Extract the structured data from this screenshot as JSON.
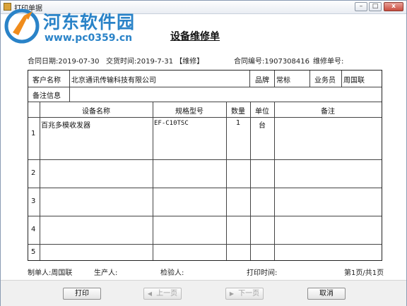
{
  "window": {
    "title": "打印单据",
    "min": "–",
    "max": "□",
    "close": "x"
  },
  "watermark": {
    "site_name": "河东软件园",
    "url": "www.pc0359.cn"
  },
  "doc": {
    "title": "设备维修单"
  },
  "info": {
    "contract_date": "合同日期:2019-07-30",
    "trade_time": "交货时间:2019-7-31 【维修】",
    "contract_no": "合同编号:1907308416",
    "repair_no": "维修单号:"
  },
  "table": {
    "customer_label": "客户名称",
    "customer_value": "北京通讯传输科技有限公司",
    "brand_label": "品牌",
    "brand_value": "常标",
    "sales_label": "业务员",
    "sales_value": "周国联",
    "remark_label": "备注信息",
    "remark_value": "",
    "headers": [
      "设备名称",
      "规格型号",
      "数量",
      "单位",
      "备注"
    ],
    "rows": [
      {
        "no": "1",
        "name": "百兆多模收发器",
        "model": "EF-C10TSC",
        "qty": "1",
        "unit": "台",
        "remark": ""
      },
      {
        "no": "2",
        "name": "",
        "model": "",
        "qty": "",
        "unit": "",
        "remark": ""
      },
      {
        "no": "3",
        "name": "",
        "model": "",
        "qty": "",
        "unit": "",
        "remark": ""
      },
      {
        "no": "4",
        "name": "",
        "model": "",
        "qty": "",
        "unit": "",
        "remark": ""
      },
      {
        "no": "5",
        "name": "",
        "model": "",
        "qty": "",
        "unit": "",
        "remark": ""
      }
    ]
  },
  "footer": {
    "maker": "制单人:周国联",
    "producer": "生产人:",
    "inspector": "检验人:",
    "print_time": "打印时间:",
    "page": "第1页/共1页"
  },
  "buttons": {
    "print": "打印",
    "prev": "上一页",
    "next": "下一页",
    "cancel": "取消"
  }
}
